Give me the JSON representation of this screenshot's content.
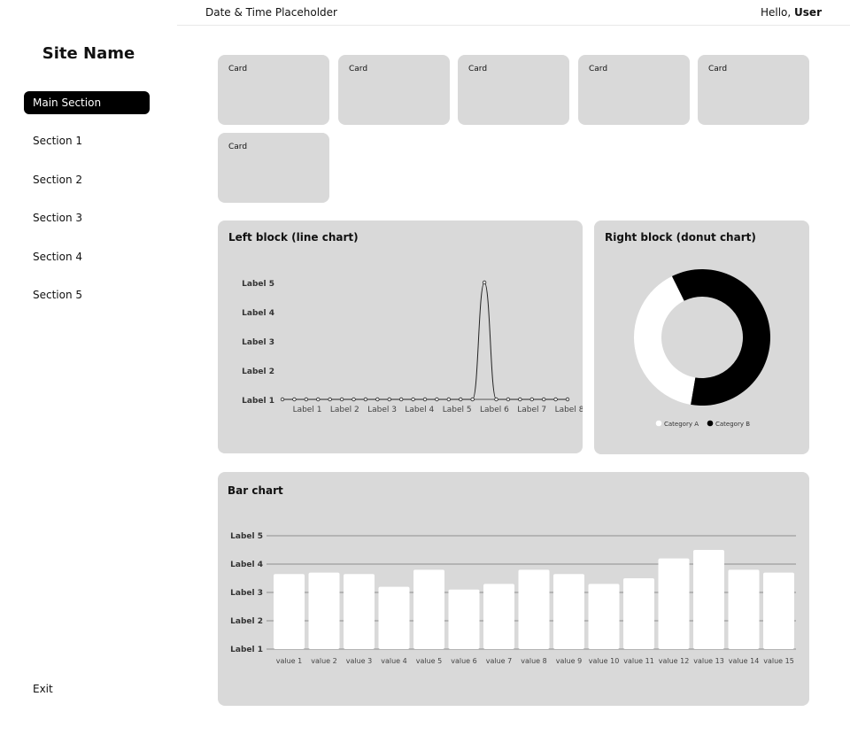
{
  "header": {
    "datetime": "Date & Time Placeholder",
    "greeting": "Hello,",
    "user": "User"
  },
  "sidebar": {
    "site_name": "Site Name",
    "items": [
      {
        "label": "Main Section",
        "active": true
      },
      {
        "label": "Section 1"
      },
      {
        "label": "Section 2"
      },
      {
        "label": "Section 3"
      },
      {
        "label": "Section 4"
      },
      {
        "label": "Section 5"
      }
    ],
    "exit_label": "Exit"
  },
  "cards": [
    {
      "label": "Card"
    },
    {
      "label": "Card"
    },
    {
      "label": "Card"
    },
    {
      "label": "Card"
    },
    {
      "label": "Card"
    },
    {
      "label": "Card"
    }
  ],
  "colors": {
    "panel": "#d9d9d9",
    "accent": "#000000",
    "bar": "#ffffff"
  },
  "chart_data": [
    {
      "type": "line",
      "title": "Left block (line chart)",
      "y_tick_labels": [
        "Label 1",
        "Label 2",
        "Label 3",
        "Label 4",
        "Label 5"
      ],
      "x_tick_labels": [
        "Label 1",
        "Label 2",
        "Label 3",
        "Label 4",
        "Label 5",
        "Label 6",
        "Label 7",
        "Label 8"
      ],
      "ylim": [
        1,
        5
      ],
      "series": [
        {
          "values": [
            1,
            1,
            1,
            1,
            1,
            1,
            1,
            1,
            1,
            1,
            1,
            1,
            1,
            1,
            1,
            1,
            1,
            5,
            1,
            1,
            1,
            1,
            1,
            1,
            1
          ]
        }
      ]
    },
    {
      "type": "pie",
      "title": "Right block (donut chart)",
      "legend": "bottom",
      "slices": [
        {
          "name": "Category A",
          "value": 40,
          "color": "#ffffff"
        },
        {
          "name": "Category B",
          "value": 60,
          "color": "#000000"
        }
      ]
    },
    {
      "type": "bar",
      "title": "Bar chart",
      "y_tick_labels": [
        "Label 1",
        "Label 2",
        "Label 3",
        "Label 4",
        "Label 5"
      ],
      "ylim": [
        1,
        5
      ],
      "grid": true,
      "categories": [
        "value 1",
        "value 2",
        "value 3",
        "value 4",
        "value 5",
        "value 6",
        "value 7",
        "value 8",
        "value 9",
        "value 10",
        "value 11",
        "value 12",
        "value 13",
        "value 14",
        "value 15"
      ],
      "values": [
        3.65,
        3.7,
        3.65,
        3.2,
        3.8,
        3.1,
        3.3,
        3.8,
        3.65,
        3.3,
        3.5,
        4.2,
        4.5,
        3.8,
        3.7
      ]
    }
  ]
}
